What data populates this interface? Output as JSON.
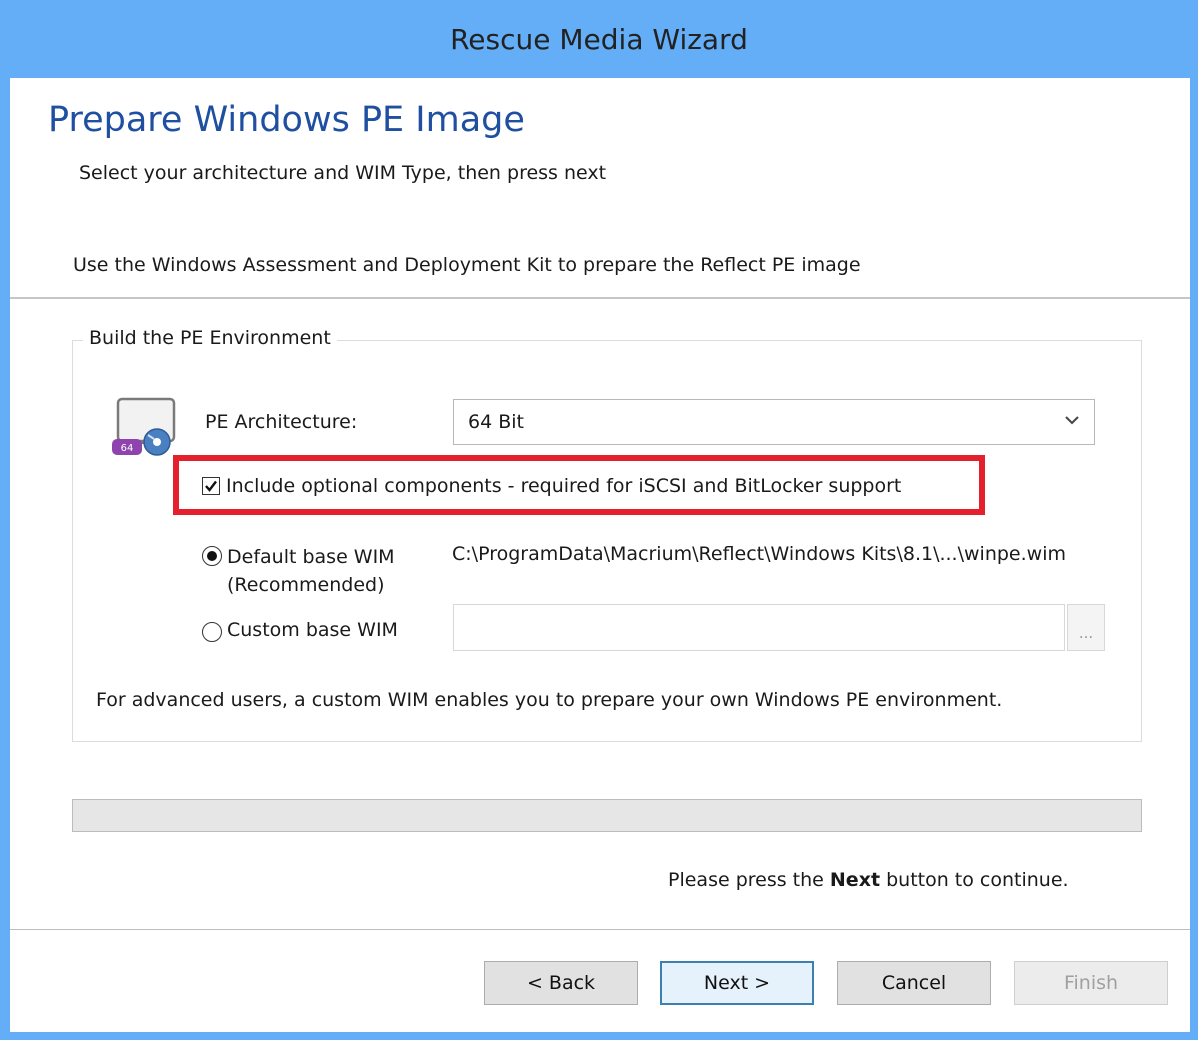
{
  "window": {
    "title": "Rescue Media Wizard"
  },
  "page": {
    "title": "Prepare Windows PE Image",
    "subtitle": "Select your architecture and WIM Type, then press next",
    "info": "Use the Windows Assessment and Deployment Kit to prepare the Reflect PE image"
  },
  "group": {
    "legend": "Build the PE Environment",
    "icon_badge": "64",
    "arch_label": "PE Architecture:",
    "arch_value": "64 Bit",
    "optional_components": {
      "label": "Include optional components - required for iSCSI and BitLocker support",
      "checked": true
    },
    "default_wim": {
      "label": "Default base WIM",
      "label2": "(Recommended)",
      "selected": true,
      "path": "C:\\ProgramData\\Macrium\\Reflect\\Windows Kits\\8.1\\...\\winpe.wim"
    },
    "custom_wim": {
      "label": "Custom base WIM",
      "selected": false,
      "value": "",
      "browse_label": "..."
    },
    "advanced_note": "For advanced users, a custom WIM enables you to prepare your own Windows PE environment."
  },
  "progress": {
    "value": 0
  },
  "prompt": {
    "prefix": "Please press the",
    "bold": "Next",
    "suffix": "button to continue."
  },
  "buttons": {
    "back": "< Back",
    "next": "Next >",
    "cancel": "Cancel",
    "finish": "Finish"
  },
  "colors": {
    "titlebar": "#63aef7",
    "page_title": "#1f4fa0",
    "highlight": "#e3202b",
    "badge": "#8e44ad"
  }
}
